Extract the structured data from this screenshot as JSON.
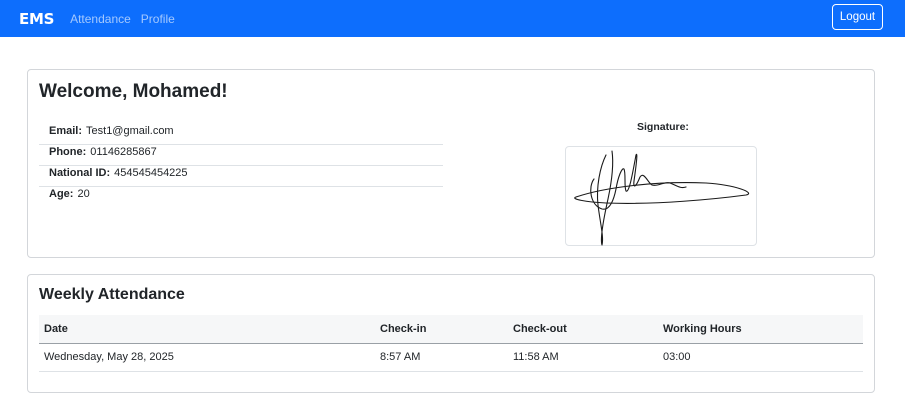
{
  "navbar": {
    "brand": "EMS",
    "links": [
      "Attendance",
      "Profile"
    ],
    "logout_label": "Logout",
    "color": "#0d6efd"
  },
  "profile": {
    "welcome": "Welcome, Mohamed!",
    "fields": [
      {
        "label": "Email:",
        "value": "Test1@gmail.com"
      },
      {
        "label": "Phone:",
        "value": "01146285867"
      },
      {
        "label": "National ID:",
        "value": "454545454225"
      },
      {
        "label": "Age:",
        "value": "20"
      }
    ],
    "signature_label": "Signature:"
  },
  "attendance": {
    "title": "Weekly Attendance",
    "columns": [
      "Date",
      "Check-in",
      "Check-out",
      "Working Hours"
    ],
    "rows": [
      [
        "Wednesday, May 28, 2025",
        "8:57 AM",
        "11:58 AM",
        "03:00"
      ]
    ]
  }
}
